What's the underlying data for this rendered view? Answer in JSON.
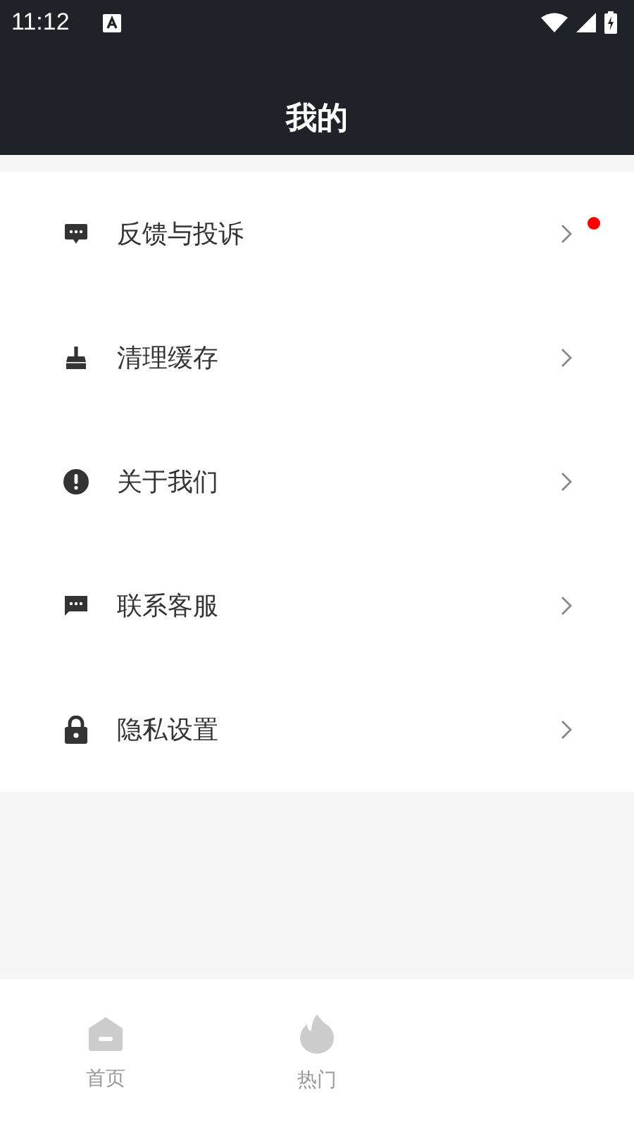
{
  "status_bar": {
    "time": "11:12"
  },
  "header": {
    "title": "我的"
  },
  "menu": [
    {
      "kind": "feedback",
      "label": "反馈与投诉",
      "badge": true
    },
    {
      "kind": "cleanup",
      "label": "清理缓存",
      "badge": false
    },
    {
      "kind": "about",
      "label": "关于我们",
      "badge": false
    },
    {
      "kind": "service",
      "label": "联系客服",
      "badge": false
    },
    {
      "kind": "privacy",
      "label": "隐私设置",
      "badge": false
    }
  ],
  "tabs": [
    {
      "kind": "home",
      "label": "首页",
      "selected": false
    },
    {
      "kind": "trending",
      "label": "热门",
      "selected": false
    }
  ]
}
